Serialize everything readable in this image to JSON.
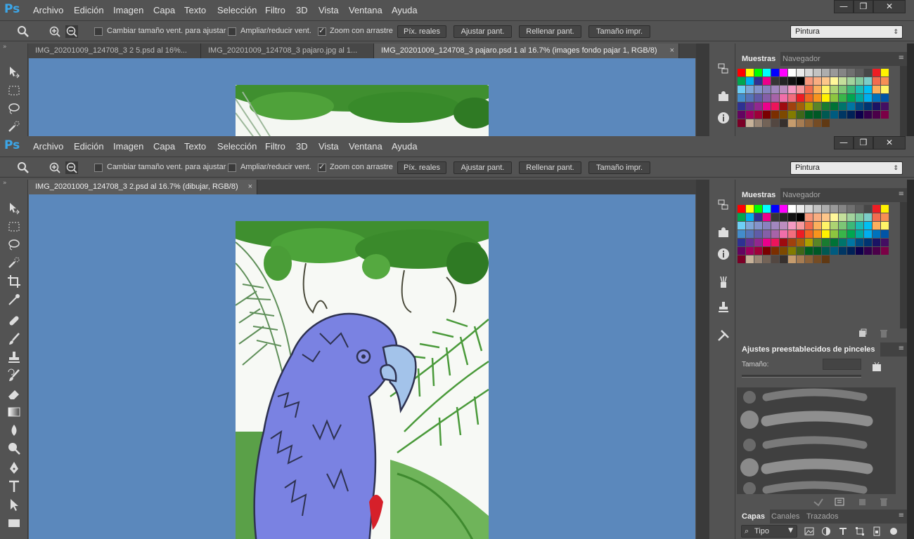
{
  "app": {
    "logo": "Ps"
  },
  "menu": [
    "Archivo",
    "Edición",
    "Imagen",
    "Capa",
    "Texto",
    "Selección",
    "Filtro",
    "3D",
    "Vista",
    "Ventana",
    "Ayuda"
  ],
  "window_controls": {
    "minimize": "—",
    "restore": "❐",
    "close": "✕"
  },
  "options": {
    "cambiar_tamano": "Cambiar tamaño vent. para ajustar",
    "ampliar_reducir": "Ampliar/reducir vent.",
    "zoom_arrastre": "Zoom con arrastre",
    "pix_reales": "Píx. reales",
    "ajustar_pant": "Ajustar pant.",
    "rellenar_pant": "Rellenar pant.",
    "tamano_impr": "Tamaño impr.",
    "workspace": "Pintura",
    "cambiar_checked": false,
    "ampliar_checked": false,
    "zoom_checked": true
  },
  "win1_tabs": [
    "IMG_20201009_124708_3 2 5.psd al 16%...",
    "IMG_20201009_124708_3 pajaro.jpg al 1...",
    "IMG_20201009_124708_3 pajaro.psd 1 al 16.7% (images fondo pajar 1, RGB/8)"
  ],
  "win2_tabs": [
    "IMG_20201009_124708_3 2.psd al 16.7% (dibujar, RGB/8)"
  ],
  "tab_close": "×",
  "panels": {
    "muestras": "Muestras",
    "navegador": "Navegador",
    "brush_title": "Ajustes preestablecidos de pinceles",
    "tamano": "Tamaño:",
    "capas": "Capas",
    "canales": "Canales",
    "trazados": "Trazados",
    "tipo": "Tipo"
  }
}
